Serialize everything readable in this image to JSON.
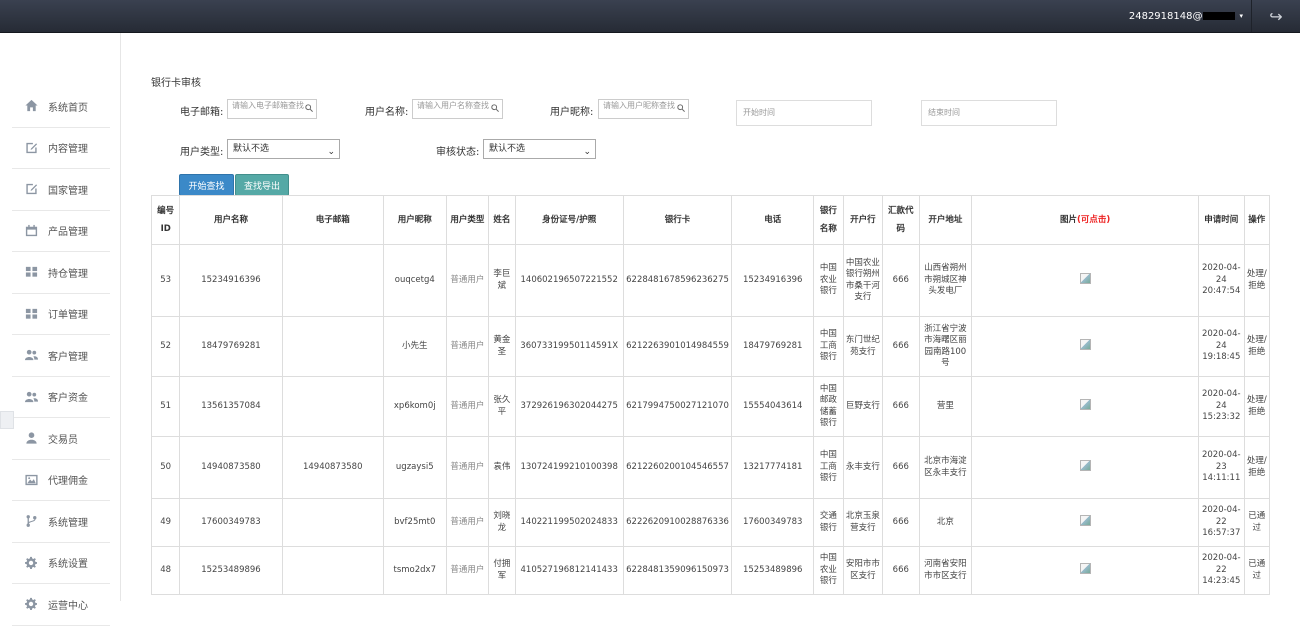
{
  "topbar": {
    "user": "2482918148@",
    "caret": "▾",
    "share_icon": "↪"
  },
  "sidebar": {
    "items": [
      {
        "label": "系统首页",
        "icon": "home-icon"
      },
      {
        "label": "内容管理",
        "icon": "edit-icon"
      },
      {
        "label": "国家管理",
        "icon": "edit-icon"
      },
      {
        "label": "产品管理",
        "icon": "calendar-icon"
      },
      {
        "label": "持仓管理",
        "icon": "grid-icon"
      },
      {
        "label": "订单管理",
        "icon": "grid-icon"
      },
      {
        "label": "客户管理",
        "icon": "users-icon"
      },
      {
        "label": "客户资金",
        "icon": "users-icon"
      },
      {
        "label": "交易员",
        "icon": "user-icon"
      },
      {
        "label": "代理佣金",
        "icon": "image-icon"
      },
      {
        "label": "系统管理",
        "icon": "branch-icon"
      },
      {
        "label": "系统设置",
        "icon": "gear-icon"
      },
      {
        "label": "运营中心",
        "icon": "gear-icon"
      }
    ]
  },
  "page": {
    "title": "银行卡审核"
  },
  "filters": {
    "email_label": "电子邮箱:",
    "email_placeholder": "请输入电子邮箱查找",
    "name_label": "用户名称:",
    "name_placeholder": "请输入用户名称查找",
    "nick_label": "用户昵称:",
    "nick_placeholder": "请输入用户昵称查找",
    "start_placeholder": "开始时间",
    "end_placeholder": "结束时间",
    "type_label": "用户类型:",
    "type_value": "默认不选",
    "status_label": "审核状态:",
    "status_value": "默认不选",
    "search_btn": "开始查找",
    "export_btn": "查找导出"
  },
  "table": {
    "headers": {
      "id": "编号ID",
      "username": "用户名称",
      "email": "电子邮箱",
      "nick": "用户昵称",
      "type": "用户类型",
      "realname": "姓名",
      "idcard": "身份证号/护照",
      "bankcard": "银行卡",
      "phone": "电话",
      "bank": "银行名称",
      "branch": "开户行",
      "swift": "汇款代码",
      "address": "开户地址",
      "image": "图片",
      "image_hint": "(可点击)",
      "time": "申请时间",
      "op": "操作"
    },
    "rows": [
      {
        "id": "53",
        "username": "15234916396",
        "email": "",
        "nick": "ouqcetg4",
        "type": "普通用户",
        "realname": "李巨斌",
        "idcard": "140602196507221552",
        "bankcard": "6228481678596236275",
        "phone": "15234916396",
        "bank": "中国农业银行",
        "branch": "中国农业银行朔州市桑干河支行",
        "swift": "666",
        "address": "山西省朔州市朔城区神头发电厂",
        "time": "2020-04-24 20:47:54",
        "op": "处理/拒绝"
      },
      {
        "id": "52",
        "username": "18479769281",
        "email": "",
        "nick": "小先生",
        "type": "普通用户",
        "realname": "黄金圣",
        "idcard": "36073319950114591X",
        "bankcard": "6212263901014984559",
        "phone": "18479769281",
        "bank": "中国工商银行",
        "branch": "东门世纪苑支行",
        "swift": "666",
        "address": "浙江省宁波市海曙区丽园南路100号",
        "time": "2020-04-24 19:18:45",
        "op": "处理/拒绝"
      },
      {
        "id": "51",
        "username": "13561357084",
        "email": "",
        "nick": "xp6kom0j",
        "type": "普通用户",
        "realname": "张久平",
        "idcard": "372926196302044275",
        "bankcard": "6217994750027121070",
        "phone": "15554043614",
        "bank": "中国邮政储蓄银行",
        "branch": "巨野支行",
        "swift": "666",
        "address": "营里",
        "time": "2020-04-24 15:23:32",
        "op": "处理/拒绝"
      },
      {
        "id": "50",
        "username": "14940873580",
        "email": "14940873580",
        "nick": "ugzaysi5",
        "type": "普通用户",
        "realname": "袁伟",
        "idcard": "130724199210100398",
        "bankcard": "6212260200104546557",
        "phone": "13217774181",
        "bank": "中国工商银行",
        "branch": "永丰支行",
        "swift": "666",
        "address": "北京市海淀区永丰支行",
        "time": "2020-04-23 14:11:11",
        "op": "处理/拒绝"
      },
      {
        "id": "49",
        "username": "17600349783",
        "email": "",
        "nick": "bvf25mt0",
        "type": "普通用户",
        "realname": "刘晓龙",
        "idcard": "140221199502024833",
        "bankcard": "6222620910028876336",
        "phone": "17600349783",
        "bank": "交通银行",
        "branch": "北京玉泉营支行",
        "swift": "666",
        "address": "北京",
        "time": "2020-04-22 16:57:37",
        "op": "已通过"
      },
      {
        "id": "48",
        "username": "15253489896",
        "email": "",
        "nick": "tsmo2dx7",
        "type": "普通用户",
        "realname": "付拥军",
        "idcard": "410527196812141433",
        "bankcard": "6228481359096150973",
        "phone": "15253489896",
        "bank": "中国农业银行",
        "branch": "安阳市市区支行",
        "swift": "666",
        "address": "河南省安阳市市区支行",
        "time": "2020-04-22 14:23:45",
        "op": "已通过"
      }
    ]
  }
}
